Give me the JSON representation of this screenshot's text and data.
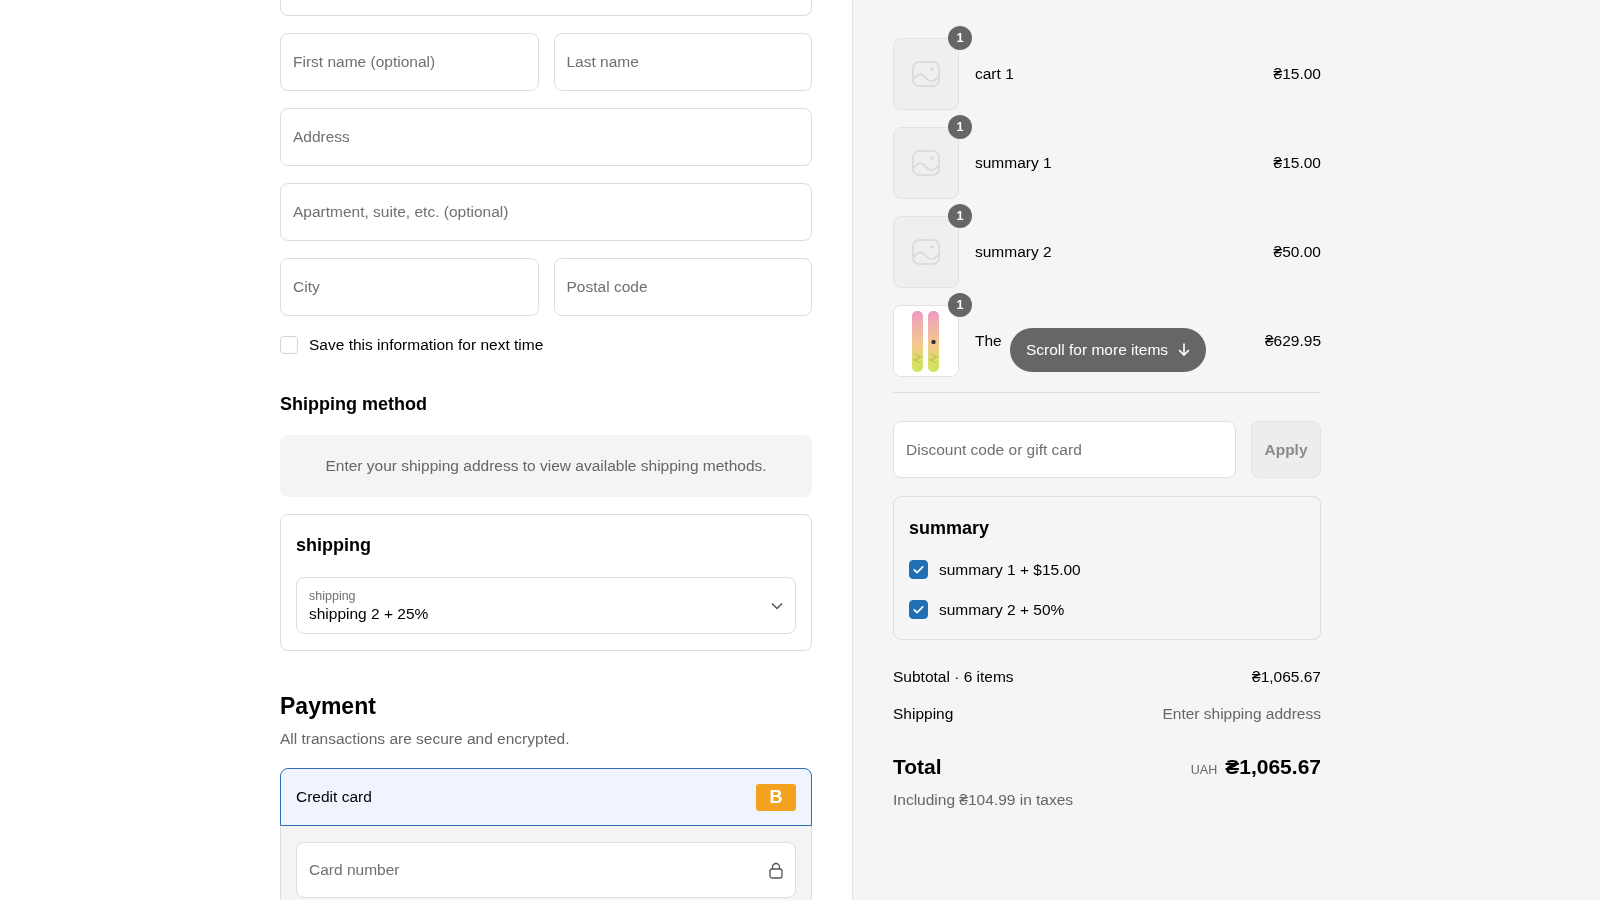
{
  "address_form": {
    "field_rows": [
      [
        {
          "placeholder": "First name (optional)"
        },
        {
          "placeholder": "Last name"
        }
      ],
      [
        {
          "placeholder": "Address"
        }
      ],
      [
        {
          "placeholder": "Apartment, suite, etc. (optional)"
        }
      ],
      [
        {
          "placeholder": "City"
        },
        {
          "placeholder": "Postal code"
        }
      ]
    ],
    "save_info": {
      "label": "Save this information for next time",
      "checked": false
    }
  },
  "shipping_method": {
    "title": "Shipping method",
    "notice": "Enter your shipping address to view available shipping methods."
  },
  "shipping_card": {
    "title": "shipping",
    "select": {
      "label": "shipping",
      "value": "shipping 2 + 25%"
    }
  },
  "payment": {
    "title": "Payment",
    "subtitle": "All transactions are secure and encrypted.",
    "methods": [
      {
        "label": "Credit card",
        "selected": true,
        "badge": "B"
      }
    ],
    "card_number": {
      "placeholder": "Card number"
    }
  },
  "cart_items": [
    {
      "kind": "placeholder",
      "quantity": "1",
      "name": "cart 1",
      "price": "₴15.00"
    },
    {
      "kind": "placeholder",
      "quantity": "1",
      "name": "summary 1",
      "price": "₴15.00"
    },
    {
      "kind": "placeholder",
      "quantity": "1",
      "name": "summary 2",
      "price": "₴50.00"
    },
    {
      "kind": "picture",
      "quantity": "1",
      "name": "The",
      "price": "₴629.95"
    }
  ],
  "scroll_hint": "Scroll for more items",
  "discount": {
    "placeholder": "Discount code or gift card",
    "button": "Apply",
    "disabled": true
  },
  "summary_box": {
    "title": "summary",
    "options": [
      {
        "label": "summary 1 + $15.00",
        "checked": true
      },
      {
        "label": "summary 2 + 50%",
        "checked": true
      }
    ]
  },
  "totals": {
    "subtotal_label": "Subtotal · 6 items",
    "subtotal": "₴1,065.67",
    "shipping_label": "Shipping",
    "shipping": "Enter shipping address",
    "total_label": "Total",
    "currency": "UAH",
    "total": "₴1,065.67",
    "taxes": "Including ₴104.99 in taxes"
  }
}
